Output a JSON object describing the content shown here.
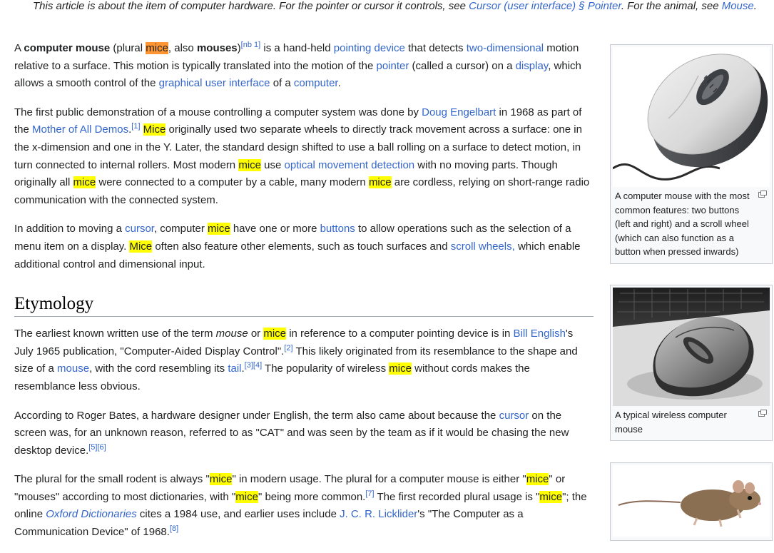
{
  "hatnote": {
    "part1": "This article is about the item of computer hardware. For the pointer or cursor it controls, see ",
    "link1": "Cursor (user interface) § Pointer",
    "part2": ". For the animal, see ",
    "link2": "Mouse",
    "part3": "."
  },
  "intro_p1": {
    "t1": "A ",
    "b1": "computer mouse",
    "t2": " (plural ",
    "h1": "mice",
    "t3": ", also ",
    "b2": "mouses",
    "t3b": ")",
    "sup1": "[nb 1]",
    "t4": " is a hand-held ",
    "l1": "pointing device",
    "t5": " that detects ",
    "l2": "two-dimensional",
    "t6": " motion relative to a surface. This motion is typically translated into the motion of the ",
    "l3": "pointer",
    "t7": " (called a cursor) on a ",
    "l4": "display",
    "t8": ", which allows a smooth control of the ",
    "l5": "graphical user interface",
    "t9": " of a ",
    "l6": "computer",
    "t10": "."
  },
  "intro_p2": {
    "t1": "The first public demonstration of a mouse controlling a computer system was done by ",
    "l1": "Doug Engelbart",
    "t2": " in 1968 as part of the ",
    "l2": "Mother of All Demos",
    "t2b": ".",
    "sup1": "[1]",
    "t3": " ",
    "h1": "Mice",
    "t4": " originally used two separate wheels to directly track movement across a surface: one in the x-dimension and one in the Y. Later, the standard design shifted to use a ball rolling on a surface to detect motion, in turn connected to internal rollers. Most modern ",
    "h2": "mice",
    "t5": " use ",
    "l3": "optical movement detection",
    "t6": " with no moving parts. Though originally all ",
    "h3": "mice",
    "t7": " were connected to a computer by a cable, many modern ",
    "h4": "mice",
    "t8": " are cordless, relying on short-range radio communication with the connected system."
  },
  "intro_p3": {
    "t1": "In addition to moving a ",
    "l1": "cursor",
    "t2": ", computer ",
    "h1": "mice",
    "t3": " have one or more ",
    "l2": "buttons",
    "t4": " to allow operations such as the selection of a menu item on a display. ",
    "h2": "Mice",
    "t5": " often also feature other elements, such as touch surfaces and ",
    "l3": "scroll wheels,",
    "t6": " which enable additional control and dimensional input."
  },
  "etymology": {
    "heading": "Etymology",
    "p1": {
      "t1": "The earliest known written use of the term ",
      "i1": "mouse",
      "t2": " or ",
      "h1": "mice",
      "t3": " in reference to a computer pointing device is in ",
      "l1": "Bill English",
      "t4": "'s July 1965 publication, \"Computer-Aided Display Control\".",
      "sup1": "[2]",
      "t5": " This likely originated from its resemblance to the shape and size of a ",
      "l2": "mouse",
      "t6": ", with the cord resembling its ",
      "l3": "tail",
      "t6b": ".",
      "sup2": "[3][4]",
      "t7": " The popularity of wireless ",
      "h2": "mice",
      "t8": " without cords makes the resemblance less obvious."
    },
    "p2": {
      "t1": "According to Roger Bates, a hardware designer under English, the term also came about because the ",
      "l1": "cursor",
      "t2": " on the screen was, for an unknown reason, referred to as \"CAT\" and was seen by the team as if it would be chasing the new desktop device.",
      "sup1": "[5][6]"
    },
    "p3": {
      "t1": "The plural for the small rodent is always \"",
      "h1": "mice",
      "t2": "\" in modern usage. The plural for a computer mouse is either \"",
      "h2": "mice",
      "t3": "\" or \"mouses\" according to most dictionaries, with \"",
      "h3": "mice",
      "t4": "\" being more common.",
      "sup1": "[7]",
      "t5": " The first recorded plural usage is \"",
      "h4": "mice",
      "t6": "\"; the online ",
      "l1": "Oxford Dictionaries",
      "t7": " cites a 1984 use, and earlier uses include ",
      "l2": "J. C. R. Licklider",
      "t8": "'s \"The Computer as a Communication Device\" of 1968.",
      "sup2": "[8]"
    }
  },
  "figures": [
    {
      "caption": "A computer mouse with the most common features: two buttons (left and right) and a scroll wheel (which can also function as a button when pressed inwards)",
      "icon": "enlarge-icon"
    },
    {
      "caption": "A typical wireless computer mouse",
      "icon": "enlarge-icon"
    },
    {
      "caption": "",
      "icon": "enlarge-icon"
    }
  ],
  "colors": {
    "link": "#3366cc",
    "highlight": "#ffff00",
    "current_highlight": "#ff9632"
  }
}
